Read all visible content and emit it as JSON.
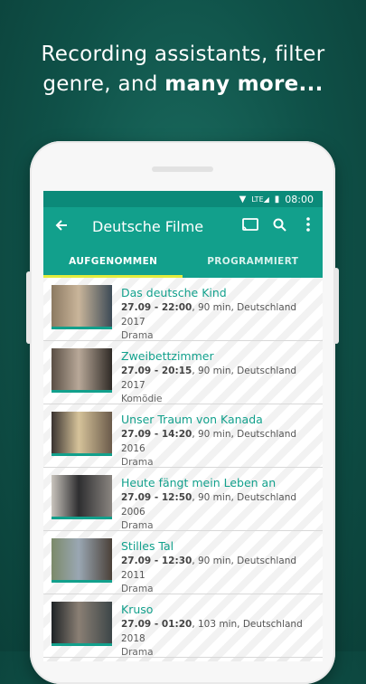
{
  "headline": {
    "line1": "Recording assistants, filter",
    "line2_regular": "genre, and ",
    "line2_bold": "many more..."
  },
  "status_bar": {
    "time": "08:00",
    "network": "LTE"
  },
  "app_bar": {
    "title": "Deutsche Filme"
  },
  "tabs": [
    {
      "label": "AUFGENOMMEN"
    },
    {
      "label": "PROGRAMMIERT"
    }
  ],
  "recordings": [
    {
      "title": "Das deutsche Kind",
      "when": "27.09 - 22:00",
      "details": ", 90 min, Deutschland 2017",
      "genre": "Drama",
      "colors": [
        "#8c7a62",
        "#c9b59a",
        "#3c4a56"
      ]
    },
    {
      "title": "Zweibettzimmer",
      "when": "27.09 - 20:15",
      "details": ", 90 min, Deutschland 2017",
      "genre": "Komödie",
      "colors": [
        "#5a4f45",
        "#b8a898",
        "#2f2a26"
      ]
    },
    {
      "title": "Unser Traum von Kanada",
      "when": "27.09 - 14:20",
      "details": ", 90 min, Deutschland 2016",
      "genre": "Drama",
      "colors": [
        "#3a3330",
        "#d6c39a",
        "#6a5a4a"
      ]
    },
    {
      "title": "Heute fängt mein Leben an",
      "when": "27.09 - 12:50",
      "details": ", 90 min, Deutschland 2006",
      "genre": "Drama",
      "colors": [
        "#c9c4bd",
        "#2e2e30",
        "#8a8580"
      ]
    },
    {
      "title": "Stilles Tal",
      "when": "27.09 - 12:30",
      "details": ", 90 min, Deutschland 2011",
      "genre": "Drama",
      "colors": [
        "#7b8a6a",
        "#9aa7b3",
        "#4a4038"
      ]
    },
    {
      "title": "Kruso",
      "when": "27.09 - 01:20",
      "details": ", 103 min, Deutschland 2018",
      "genre": "Drama",
      "colors": [
        "#1e2326",
        "#8a7f74",
        "#3d4648"
      ]
    }
  ]
}
